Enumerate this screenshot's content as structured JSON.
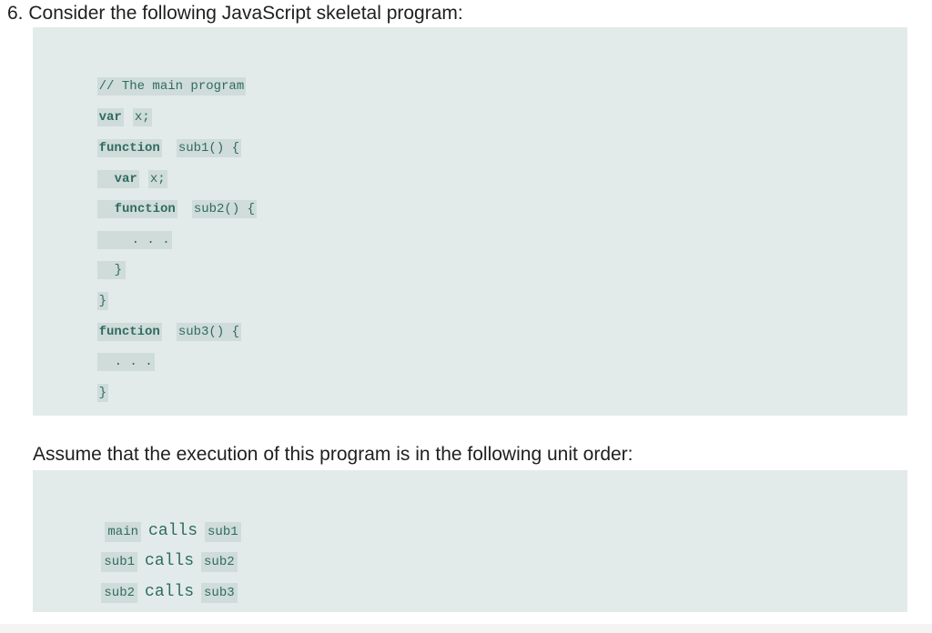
{
  "question": {
    "title": "6. Consider the following JavaScript skeletal program:"
  },
  "code": {
    "comment": "// The main program",
    "var_kw": "var",
    "var_x": "x;",
    "function_kw": "function",
    "sub1_sig": "sub1() {",
    "inner_var_kw": "var",
    "inner_var_x": "x;",
    "inner_function_kw": "function",
    "sub2_sig": "sub2() {",
    "sub2_body": ". . .",
    "sub2_close": "}",
    "sub1_close": "}",
    "function3_kw": "function",
    "sub3_sig": "sub3() {",
    "sub3_body": ". . .",
    "sub3_close": "}"
  },
  "paragraph": "Assume that the execution of this program is in the following unit order:",
  "call_order": [
    {
      "caller": "main",
      "verb": "calls",
      "callee": "sub1"
    },
    {
      "caller": "sub1",
      "verb": "calls",
      "callee": "sub2"
    },
    {
      "caller": "sub2",
      "verb": "calls",
      "callee": "sub3"
    }
  ]
}
